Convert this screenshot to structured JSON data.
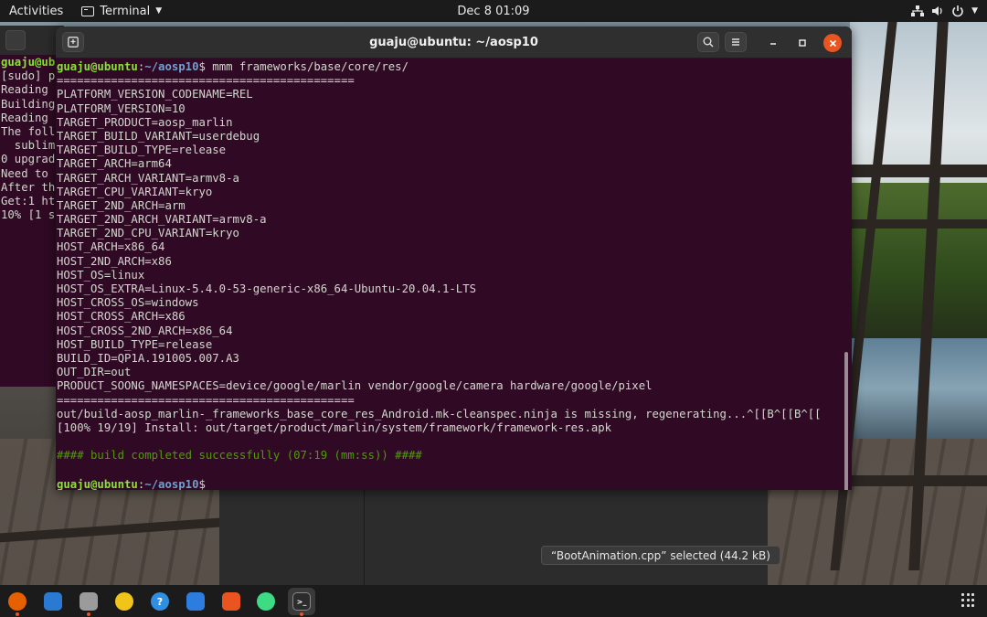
{
  "topbar": {
    "activities": "Activities",
    "app_name": "Terminal",
    "clock": "Dec 8  01:09"
  },
  "background_terminal": {
    "lines": [
      "guaju@ubu",
      "[sudo] p",
      "Reading ",
      "Building",
      "Reading ",
      "The foll",
      "  sublim",
      "0 upgrad",
      "Need to ",
      "After th",
      "Get:1 ht",
      "10% [1 s"
    ]
  },
  "terminal": {
    "title": "guaju@ubuntu: ~/aosp10",
    "prompt_user": "guaju@ubuntu",
    "prompt_path": "~/aosp10",
    "command": "mmm frameworks/base/core/res/",
    "output": [
      "============================================",
      "PLATFORM_VERSION_CODENAME=REL",
      "PLATFORM_VERSION=10",
      "TARGET_PRODUCT=aosp_marlin",
      "TARGET_BUILD_VARIANT=userdebug",
      "TARGET_BUILD_TYPE=release",
      "TARGET_ARCH=arm64",
      "TARGET_ARCH_VARIANT=armv8-a",
      "TARGET_CPU_VARIANT=kryo",
      "TARGET_2ND_ARCH=arm",
      "TARGET_2ND_ARCH_VARIANT=armv8-a",
      "TARGET_2ND_CPU_VARIANT=kryo",
      "HOST_ARCH=x86_64",
      "HOST_2ND_ARCH=x86",
      "HOST_OS=linux",
      "HOST_OS_EXTRA=Linux-5.4.0-53-generic-x86_64-Ubuntu-20.04.1-LTS",
      "HOST_CROSS_OS=windows",
      "HOST_CROSS_ARCH=x86",
      "HOST_CROSS_2ND_ARCH=x86_64",
      "HOST_BUILD_TYPE=release",
      "BUILD_ID=QP1A.191005.007.A3",
      "OUT_DIR=out",
      "PRODUCT_SOONG_NAMESPACES=device/google/marlin vendor/google/camera hardware/google/pixel",
      "============================================",
      "out/build-aosp_marlin-_frameworks_base_core_res_Android.mk-cleanspec.ninja is missing, regenerating...^[[B^[[B^[[",
      "[100% 19/19] Install: out/target/product/marlin/system/framework/framework-res.apk",
      ""
    ],
    "success_message": "#### build completed successfully (07:19 (mm:ss)) ####"
  },
  "files": {
    "status": "“BootAnimation.cpp” selected  (44.2 kB)"
  },
  "dock": [
    {
      "name": "firefox-icon",
      "color": "#e66000"
    },
    {
      "name": "thunderbird-icon",
      "color": "#2a7ad4"
    },
    {
      "name": "files-icon",
      "color": "#9b9b9b"
    },
    {
      "name": "rhythmbox-icon",
      "color": "#f0c419"
    },
    {
      "name": "help-icon",
      "color": "#2f8fe0"
    },
    {
      "name": "libreoffice-writer-icon",
      "color": "#2d7de0"
    },
    {
      "name": "software-center-icon",
      "color": "#e95420"
    },
    {
      "name": "android-studio-icon",
      "color": "#3ddc84"
    },
    {
      "name": "terminal-icon",
      "color": "#2c2c2c"
    }
  ]
}
